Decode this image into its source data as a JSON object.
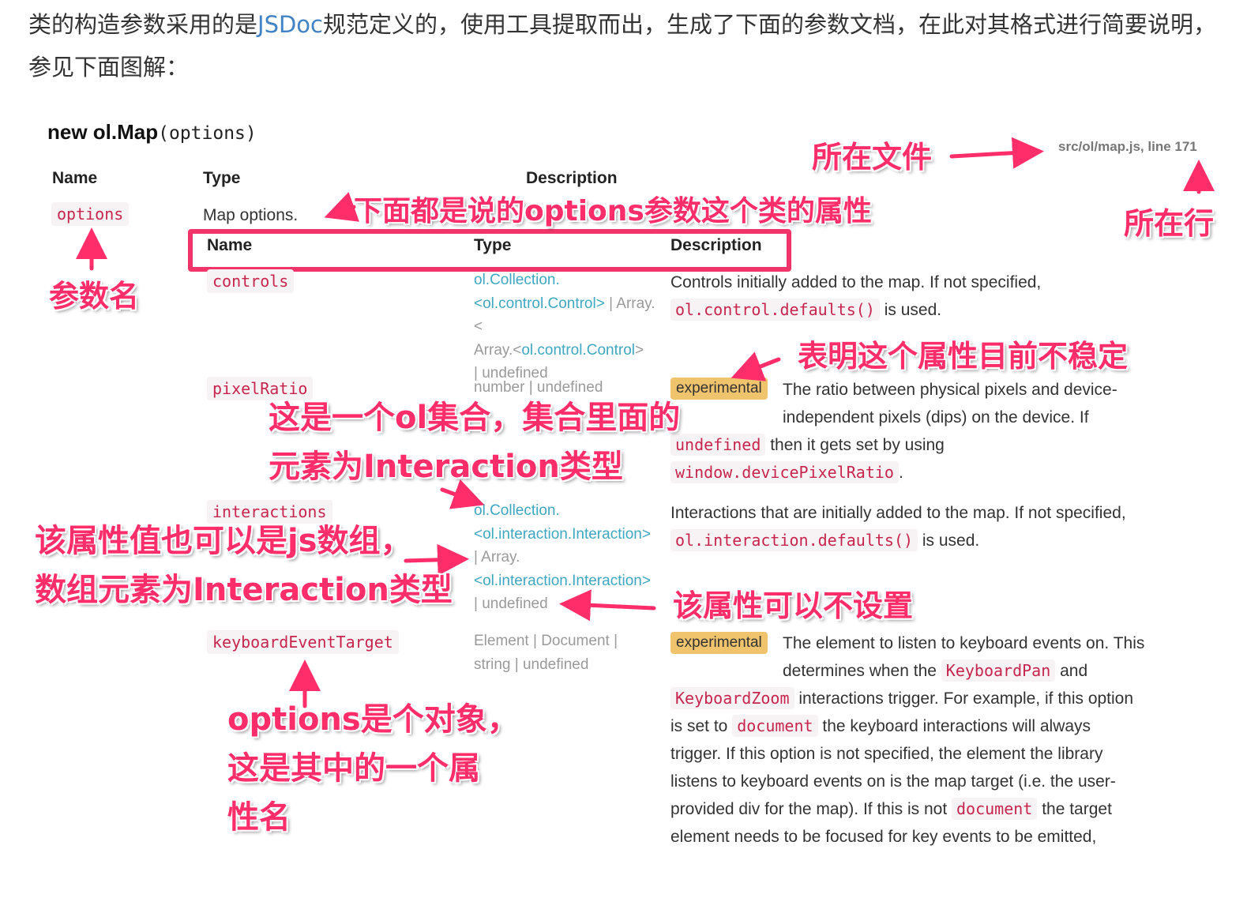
{
  "intro": {
    "before": "类的构造参数采用的是",
    "link": "JSDoc",
    "after": "规范定义的，使用工具提取而出，生成了下面的参数文档，在此对其格式进行简要说明，参见下面图解："
  },
  "doc": {
    "title_bold": "new ol.Map",
    "title_sig": "(options)",
    "source_ref": "src/ol/map.js, line 171",
    "headers": {
      "name": "Name",
      "type": "Type",
      "description": "Description"
    },
    "param": {
      "name": "options",
      "type": "Map options."
    },
    "sub_headers": {
      "name": "Name",
      "type": "Type",
      "description": "Description"
    },
    "experimental_badge": "experimental",
    "rows": [
      {
        "name": "controls",
        "type_parts": [
          "ol.Collection.",
          "<ol.control.Control>",
          " | Array.<",
          "ol.control.Control",
          ">",
          " | undefined"
        ],
        "desc": [
          "Controls initially added to the map. If not specified,",
          "ol.control.defaults()",
          "is used."
        ]
      },
      {
        "name": "pixelRatio",
        "type_parts": [
          "number | undefined"
        ],
        "desc": [
          "The ratio between physical pixels and device-",
          "independent pixels (dips) on the device. If",
          "undefined",
          "then it gets set by using",
          "window.devicePixelRatio",
          "."
        ]
      },
      {
        "name": "interactions",
        "type_parts": [
          "ol.Collection.",
          "<ol.interaction.Interaction>",
          "| Array.",
          "<ol.interaction.Interaction>",
          "| undefined"
        ],
        "desc": [
          "Interactions that are initially added to the map. If not specified,",
          "ol.interaction.defaults()",
          "is used."
        ]
      },
      {
        "name": "keyboardEventTarget",
        "type_parts": [
          "Element | Document |",
          "string | undefined"
        ],
        "desc": [
          "The element to listen to keyboard events on. This",
          "determines when the",
          "KeyboardPan",
          "and",
          "KeyboardZoom",
          "interactions trigger. For example, if this option",
          "is set to",
          "document",
          "the keyboard interactions will always",
          "trigger. If this option is not specified, the element the library",
          "listens to keyboard events on is the map target (i.e. the user-",
          "provided div for the map). If this is not",
          "document",
          "the target",
          "element needs to be focused for key events to be emitted,"
        ]
      }
    ]
  },
  "annotations": {
    "file": "所在文件",
    "line": "所在行",
    "props": "下面都是说的options参数这个类的属性",
    "param_name": "参数名",
    "unstable": "表明这个属性目前不稳定",
    "collection_1": "这是一个ol集合，集合里面的",
    "collection_2": "元素为Interaction类型",
    "array_1": "该属性值也可以是js数组，",
    "array_2": "数组元素为Interaction类型",
    "optional": "该属性可以不设置",
    "object_1": "options是个对象，",
    "object_2": "这是其中的一个属",
    "object_3": "性名"
  },
  "colors": {
    "annotation": "#ff2d6a",
    "code": "#c7254e",
    "link": "#3ea7c1",
    "badge": "#f0c36d"
  }
}
